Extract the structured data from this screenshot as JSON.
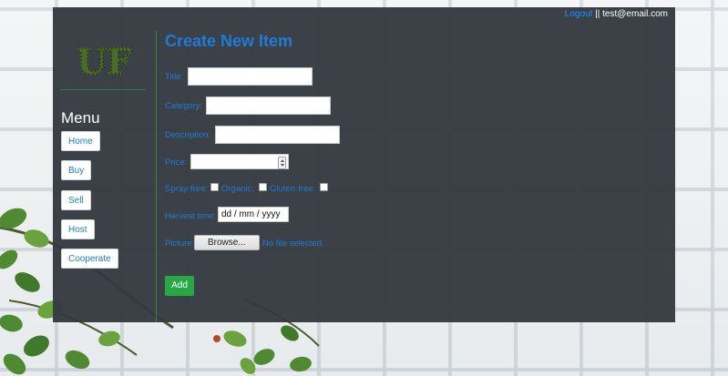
{
  "header": {
    "logout_label": "Logout",
    "separator": " || ",
    "user_email": "test@email.com"
  },
  "sidebar": {
    "logo_text": "UF",
    "menu_title": "Menu",
    "items": [
      {
        "label": "Home"
      },
      {
        "label": "Buy"
      },
      {
        "label": "Sell"
      },
      {
        "label": "Host"
      },
      {
        "label": "Cooperate"
      }
    ]
  },
  "form": {
    "title": "Create New Item",
    "title_label": "Title:",
    "title_value": "",
    "category_label": "Category:",
    "category_value": "",
    "description_label": "Description:",
    "description_value": "",
    "price_label": "Price:",
    "price_value": "",
    "spray_free_label": "Spray-free:",
    "organic_label": "Organic:",
    "gluten_free_label": "Gluten-free:",
    "harvest_label": "Harvest time:",
    "harvest_placeholder": "dd / mm / yyyy",
    "picture_label": "Picture:",
    "browse_label": "Browse...",
    "file_status": "No file selected.",
    "submit_label": "Add"
  },
  "colors": {
    "panel": "#343940",
    "accent_blue": "#1e7bd8",
    "submit_green": "#28a745",
    "divider_green": "#2f8b3c"
  }
}
